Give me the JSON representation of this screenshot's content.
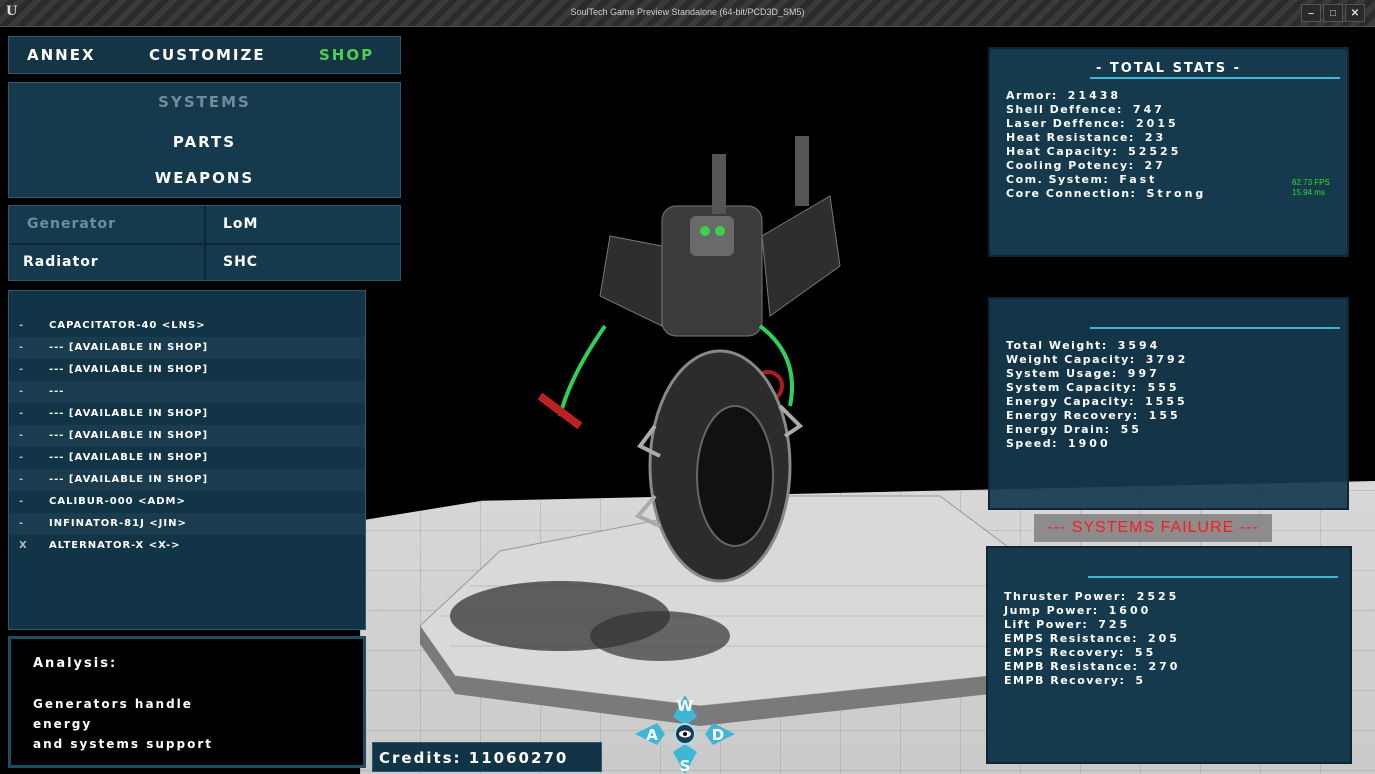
{
  "window": {
    "title": "SoulTech Game Preview Standalone (64-bit/PCD3D_SM5)",
    "logo": "unreal-logo",
    "buttons": [
      "–",
      "□",
      "✕"
    ]
  },
  "nav": {
    "tabs": [
      {
        "label": "ANNEX",
        "active": false
      },
      {
        "label": "CUSTOMIZE",
        "active": false
      },
      {
        "label": "SHOP",
        "active": true
      }
    ]
  },
  "categories": {
    "items": [
      {
        "label": "SYSTEMS",
        "selected": true
      },
      {
        "label": "PARTS",
        "selected": false
      },
      {
        "label": "WEAPONS",
        "selected": false
      }
    ]
  },
  "slots": {
    "generator": "Generator",
    "generator_value": "LoM",
    "radiator": "Radiator",
    "radiator_value": "SHC"
  },
  "parts_list": {
    "items": [
      {
        "mark": "-",
        "label": "CAPACITATOR-40 <LNS>"
      },
      {
        "mark": "-",
        "label": "--- [AVAILABLE IN SHOP]"
      },
      {
        "mark": "-",
        "label": "--- [AVAILABLE IN SHOP]"
      },
      {
        "mark": "-",
        "label": "---"
      },
      {
        "mark": "-",
        "label": "--- [AVAILABLE IN SHOP]"
      },
      {
        "mark": "-",
        "label": "--- [AVAILABLE IN SHOP]"
      },
      {
        "mark": "-",
        "label": "--- [AVAILABLE IN SHOP]"
      },
      {
        "mark": "-",
        "label": "--- [AVAILABLE IN SHOP]"
      },
      {
        "mark": "-",
        "label": "CALIBUR-000 <ADM>"
      },
      {
        "mark": "-",
        "label": "INFINATOR-81J <JIN>"
      },
      {
        "mark": "X",
        "label": "ALTERNATOR-X <X->"
      }
    ]
  },
  "analysis": {
    "heading": "Analysis:",
    "lines": [
      "Generators handle",
      "energy",
      "and systems support"
    ]
  },
  "credits": "Credits: 11060270",
  "total_stats": {
    "header": "- TOTAL STATS -",
    "rows": [
      {
        "label": "Armor:",
        "value": "21438"
      },
      {
        "label": "Shell Deffence:",
        "value": "747"
      },
      {
        "label": "Laser Deffence:",
        "value": "2015"
      },
      {
        "label": "Heat Resistance:",
        "value": "23"
      },
      {
        "label": "Heat Capacity:",
        "value": "52525"
      },
      {
        "label": "Cooling Potency:",
        "value": "27"
      },
      {
        "label": "Com. System:",
        "value": "Fast"
      },
      {
        "label": "Core Connection:",
        "value": "Strong"
      }
    ]
  },
  "weight_stats": {
    "rows": [
      {
        "label": "Total Weight:",
        "value": "3594"
      },
      {
        "label": "Weight Capacity:",
        "value": "3792"
      },
      {
        "label": "System Usage:",
        "value": "997"
      },
      {
        "label": "System Capacity:",
        "value": "555"
      },
      {
        "label": "Energy Capacity:",
        "value": "1555"
      },
      {
        "label": "Energy Recovery:",
        "value": "155"
      },
      {
        "label": "Energy Drain:",
        "value": "55"
      },
      {
        "label": "Speed:",
        "value": "1900"
      }
    ]
  },
  "failure": "--- SYSTEMS FAILURE ---",
  "mobility_stats": {
    "rows": [
      {
        "label": "Thruster Power:",
        "value": "2525"
      },
      {
        "label": "Jump Power:",
        "value": "1600"
      },
      {
        "label": "Lift Power:",
        "value": "725"
      },
      {
        "label": "EMPS Resistance:",
        "value": "205"
      },
      {
        "label": "EMPS Recovery:",
        "value": "55"
      },
      {
        "label": "EMPB Resistance:",
        "value": "270"
      },
      {
        "label": "EMPB Recovery:",
        "value": "5"
      }
    ]
  },
  "fps": {
    "line1": "62.73 FPS",
    "line2": "15.94 ms"
  },
  "wasd": {
    "w": "W",
    "a": "A",
    "s": "S",
    "d": "D"
  },
  "colors": {
    "panel": "#163a4d",
    "accent": "#3fb6d6",
    "active_tab": "#4ed14e",
    "failure_text": "#ff1b1b"
  }
}
